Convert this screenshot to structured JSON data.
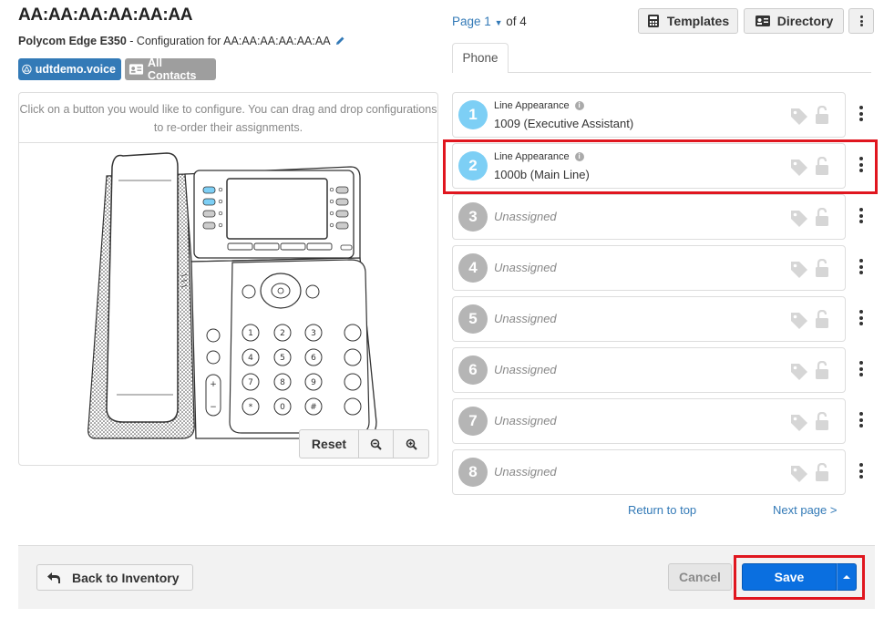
{
  "header": {
    "mac": "AA:AA:AA:AA:AA:AA",
    "model": "Polycom Edge E350",
    "config_prefix": " - Configuration for ",
    "config_mac": "AA:AA:AA:AA:AA:AA"
  },
  "tags": {
    "site": "udtdemo.voice",
    "contacts": "All Contacts"
  },
  "phone_panel": {
    "instruction": "Click on a button you would like to configure. You can drag and drop configurations to re-order their assignments.",
    "reset_label": "Reset",
    "zoom_out_icon": "zoom-out-icon",
    "zoom_in_icon": "zoom-in-icon"
  },
  "pager": {
    "page_label": "Page 1",
    "of_label": "of 4"
  },
  "toolbar": {
    "templates_label": "Templates",
    "directory_label": "Directory"
  },
  "tabs": [
    {
      "label": "Phone"
    }
  ],
  "lines": [
    {
      "number": "1",
      "type": "Line Appearance",
      "value": "1009 (Executive Assistant)",
      "assigned": true
    },
    {
      "number": "2",
      "type": "Line Appearance",
      "value": "1000b (Main Line)",
      "assigned": true,
      "highlighted": true
    },
    {
      "number": "3",
      "value": "Unassigned",
      "assigned": false
    },
    {
      "number": "4",
      "value": "Unassigned",
      "assigned": false
    },
    {
      "number": "5",
      "value": "Unassigned",
      "assigned": false
    },
    {
      "number": "6",
      "value": "Unassigned",
      "assigned": false
    },
    {
      "number": "7",
      "value": "Unassigned",
      "assigned": false
    },
    {
      "number": "8",
      "value": "Unassigned",
      "assigned": false
    }
  ],
  "links": {
    "return_top": "Return to top",
    "next_page": "Next page >"
  },
  "footer": {
    "back_label": "Back to Inventory",
    "cancel_label": "Cancel",
    "save_label": "Save"
  },
  "colors": {
    "accent": "#337ab7",
    "save": "#0a6fe0",
    "assigned_circle": "#7dcff5",
    "unassigned_circle": "#b5b5b5",
    "highlight": "#e0161f"
  }
}
